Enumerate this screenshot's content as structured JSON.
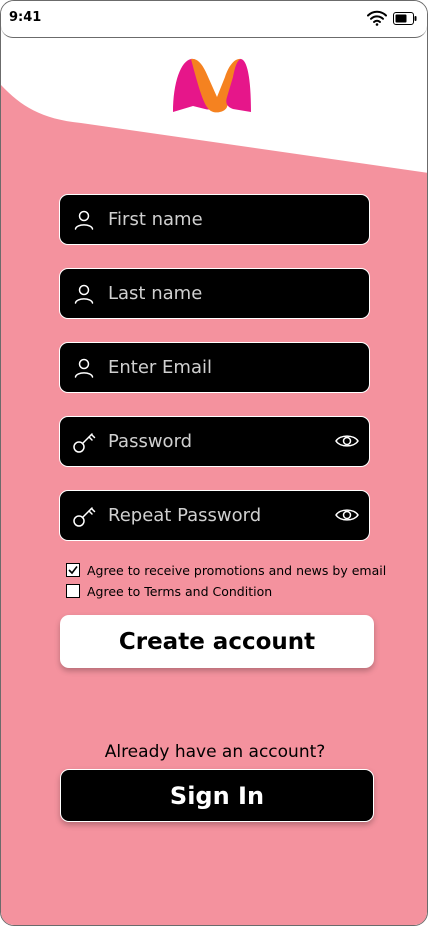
{
  "status_bar": {
    "time": "9:41"
  },
  "colors": {
    "background_pink": "#f4929e",
    "field_background": "#000000",
    "logo_magenta": "#e6168a",
    "logo_orange": "#f58220"
  },
  "logo": {
    "icon": "myntra-logo"
  },
  "form": {
    "first_name": {
      "placeholder": "First name",
      "value": "",
      "icon": "person-icon"
    },
    "last_name": {
      "placeholder": "Last name",
      "value": "",
      "icon": "person-icon"
    },
    "email": {
      "placeholder": "Enter Email",
      "value": "",
      "icon": "person-icon"
    },
    "password": {
      "placeholder": "Password",
      "value": "",
      "icon": "key-icon",
      "toggle_icon": "eye-icon"
    },
    "repeat_password": {
      "placeholder": "Repeat Password",
      "value": "",
      "icon": "key-icon",
      "toggle_icon": "eye-icon"
    }
  },
  "checkboxes": {
    "promotions": {
      "label": "Agree to receive promotions and news by email",
      "checked": true
    },
    "terms": {
      "label": "Agree to Terms and Condition",
      "checked": false
    }
  },
  "buttons": {
    "create_account": "Create account",
    "sign_in": "Sign In"
  },
  "footer": {
    "already_text": "Already have an account?"
  }
}
